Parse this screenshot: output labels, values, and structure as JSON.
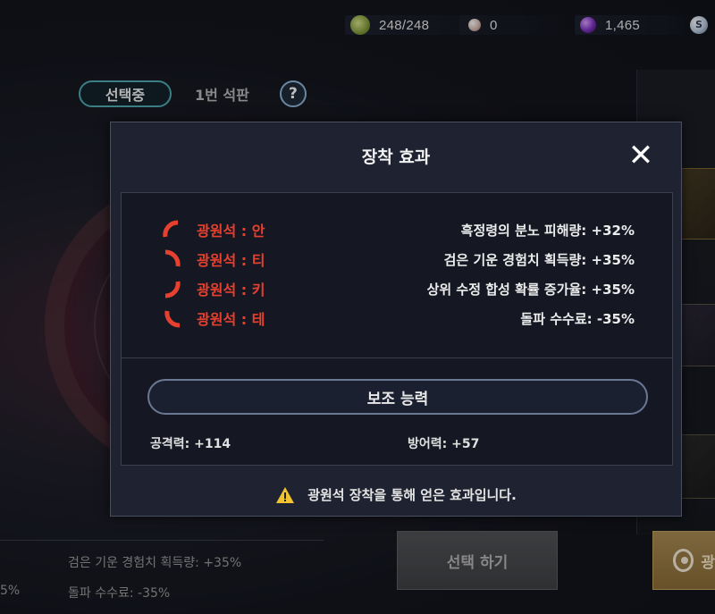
{
  "resources": {
    "stamina": "248/248",
    "pearl": "0",
    "orb": "1,465",
    "silver_icon_letter": "S"
  },
  "tabs": {
    "selected": "선택중",
    "other": "1번 석판",
    "help": "?"
  },
  "background": {
    "bottom_effect_1": "검은 기운 경험치 획득량: +35%",
    "bottom_effect_2": "돌파 수수료: -35%",
    "bottom_left_fragment": "5%",
    "select_button": "선택 하기",
    "gold_button_fragment": "광"
  },
  "modal": {
    "title": "장착 효과",
    "close": "✕",
    "effects": [
      {
        "stone": "광원석 : 안",
        "effect": "흑정령의 분노 피해량: +32%"
      },
      {
        "stone": "광원석 : 티",
        "effect": "검은 기운 경험치 획득량: +35%"
      },
      {
        "stone": "광원석 : 키",
        "effect": "상위 수정 합성 확률 증가율: +35%"
      },
      {
        "stone": "광원석 : 테",
        "effect": "돌파 수수료: -35%"
      }
    ],
    "sub_title": "보조 능력",
    "attack": "공격력: +114",
    "defense": "방어력: +57",
    "notice": "광원석 장착을 통해 얻은 효과입니다."
  },
  "colors": {
    "stone_red": "#e8402e",
    "tab_border": "#4fa8b0",
    "warning_yellow": "#f2c230"
  }
}
